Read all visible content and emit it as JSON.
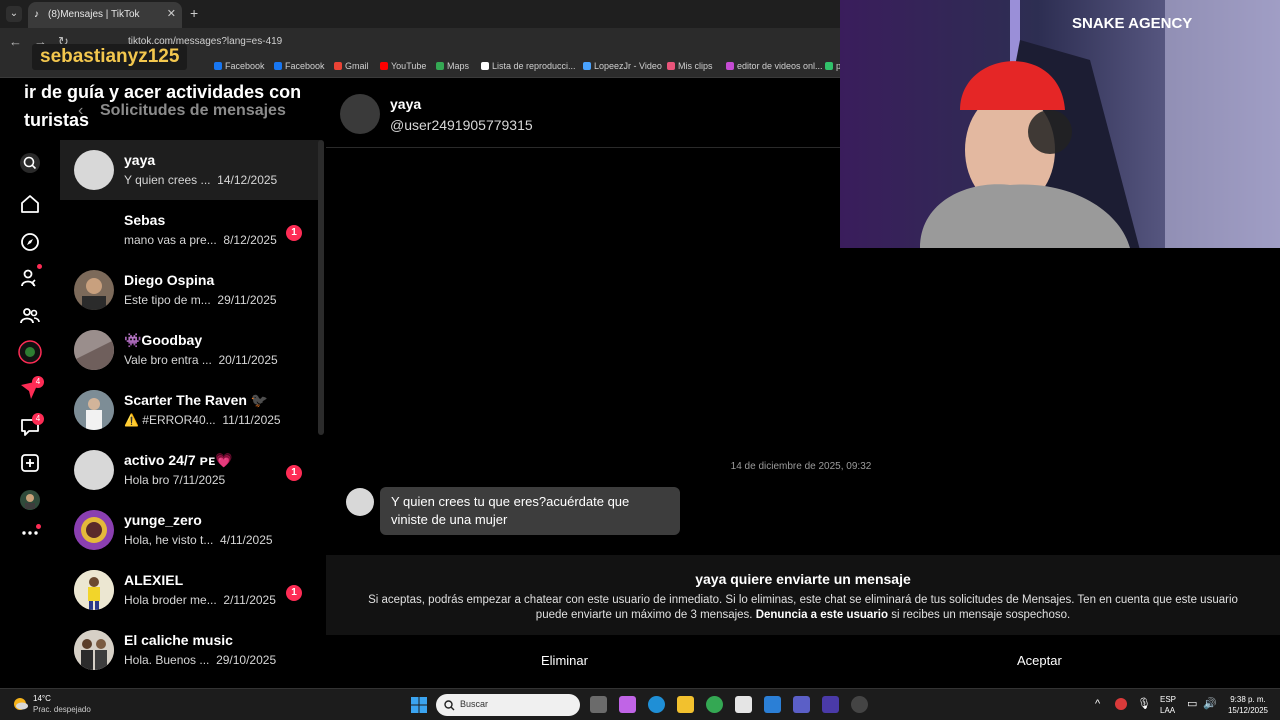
{
  "browser": {
    "tab_title": "(8)Mensajes | TikTok",
    "url": "tiktok.com/messages?lang=es-419",
    "bookmarks": [
      "Facebook",
      "Facebook",
      "Gmail",
      "YouTube",
      "Maps",
      "Lista de reproducci...",
      "LopeezJr - Video",
      "Mis clips",
      "editor de videos onl...",
      "px"
    ]
  },
  "stream": {
    "username": "sebastianyz125",
    "caption": "ir de guía y acer actividades con turistas",
    "webcam_sign": "SNAKE AGENCY"
  },
  "sidebar": {
    "header": "Solicitudes de mensajes",
    "rail_badges": {
      "inbox": "4",
      "messages": "4"
    },
    "conversations": [
      {
        "name": "yaya",
        "preview": "Y quien crees ...",
        "date": "14/12/2025",
        "badge": ""
      },
      {
        "name": "Sebas",
        "preview": "mano vas a pre...",
        "date": "8/12/2025",
        "badge": "1"
      },
      {
        "name": "Diego Ospina",
        "preview": "Este tipo de m...",
        "date": "29/11/2025",
        "badge": ""
      },
      {
        "name": "👾Goodbay",
        "preview": "Vale bro entra ...",
        "date": "20/11/2025",
        "badge": ""
      },
      {
        "name": "Scarter The Raven 🐦‍⬛",
        "preview": "⚠️ #ERROR40...",
        "date": "11/11/2025",
        "badge": ""
      },
      {
        "name": "activo 24/7 ᴘᴇ💗",
        "preview": "Hola bro",
        "date": "7/11/2025",
        "badge": "1"
      },
      {
        "name": "yunge_zero",
        "preview": "Hola, he visto t...",
        "date": "4/11/2025",
        "badge": ""
      },
      {
        "name": "ALEXIEL",
        "preview": "Hola broder me...",
        "date": "2/11/2025",
        "badge": "1"
      },
      {
        "name": "El caliche music",
        "preview": "Hola. Buenos ...",
        "date": "29/10/2025",
        "badge": ""
      }
    ]
  },
  "chat": {
    "name": "yaya",
    "handle": "@user2491905779315",
    "date_separator": "14 de diciembre de 2025, 09:32",
    "message": "Y quien crees tu que eres?acuérdate que viniste de una mujer",
    "request_title": "yaya quiere enviarte un mensaje",
    "request_text_1": "Si aceptas, podrás empezar a chatear con este usuario de inmediato. Si lo eliminas, este chat se eliminará de tus solicitudes de Mensajes. Ten en cuenta que este usuario puede enviarte un máximo de 3 mensajes. ",
    "request_link": "Denuncia a este usuario",
    "request_text_2": " si recibes un mensaje sospechoso.",
    "delete_label": "Eliminar",
    "accept_label": "Aceptar"
  },
  "taskbar": {
    "temperature": "14°C",
    "weather": "Prac. despejado",
    "search_placeholder": "Buscar",
    "language": "ESP",
    "layout": "LAA",
    "time": "9:38 p. m.",
    "date": "15/12/2025"
  },
  "colors": {
    "accent": "#fe2c55",
    "bubble": "#3d3d3d",
    "panel": "#121212"
  }
}
